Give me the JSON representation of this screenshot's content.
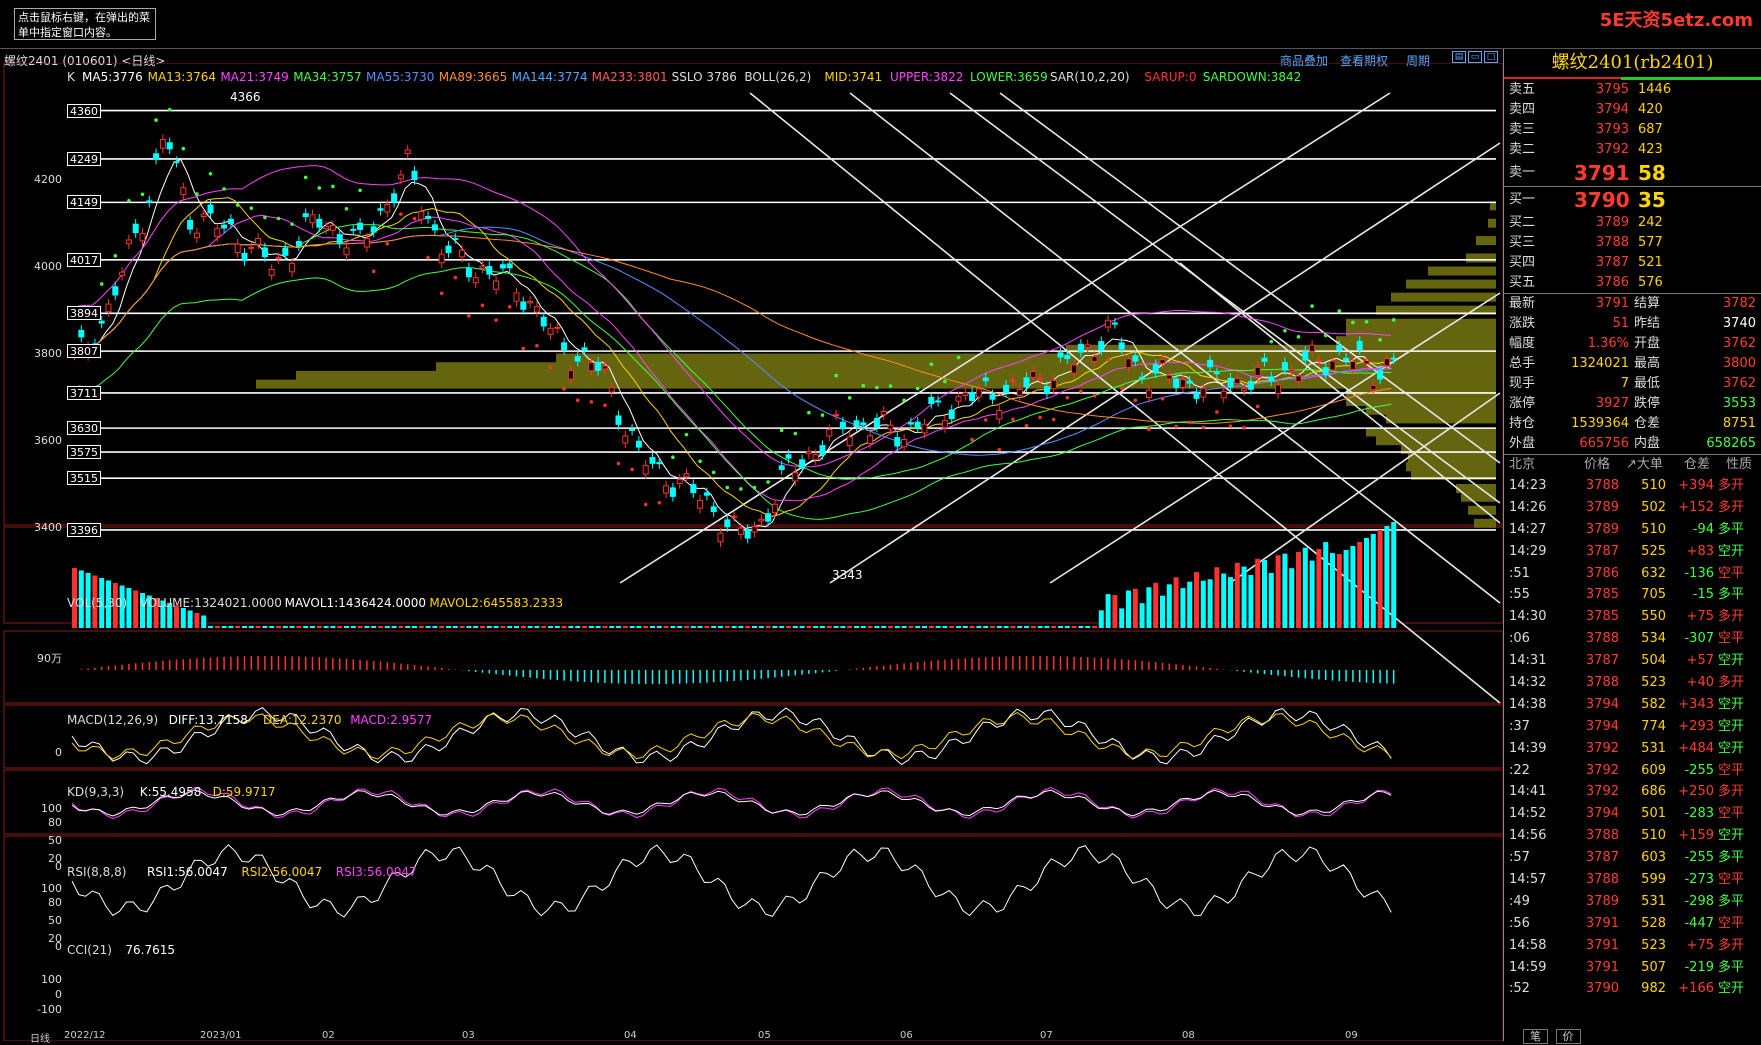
{
  "header": {
    "tip": "点击鼠标右键，在弹出的菜单中指定窗口内容。",
    "brand": "5E天资5etz.com",
    "contract": "螺纹2401 (010601) <日线>",
    "links": [
      "商品叠加",
      "查看期权",
      "周期"
    ]
  },
  "main_indicator": {
    "k": "K",
    "items": [
      {
        "text": "MA5:3776",
        "color": "#ffffff"
      },
      {
        "text": "MA13:3764",
        "color": "#ffd400"
      },
      {
        "text": "MA21:3749",
        "color": "#ff40ff"
      },
      {
        "text": "MA34:3757",
        "color": "#40ff40"
      },
      {
        "text": "MA55:3730",
        "color": "#5a8cff"
      },
      {
        "text": "MA89:3665",
        "color": "#ff8a2a"
      },
      {
        "text": "MA144:3774",
        "color": "#4fa8ff"
      },
      {
        "text": "MA233:3801",
        "color": "#ff5a5a"
      },
      {
        "text": "SSLO 3786",
        "color": "#dddddd"
      },
      {
        "text": "BOLL(26,2)",
        "color": "#dddddd"
      },
      {
        "text": "MID:3741",
        "color": "#ffd400"
      },
      {
        "text": "UPPER:3822",
        "color": "#ff40ff"
      },
      {
        "text": "LOWER:3659",
        "color": "#40ff40"
      },
      {
        "text": "SAR(10,2,20)",
        "color": "#dddddd"
      },
      {
        "text": "SARUP:0",
        "color": "#ff3030"
      },
      {
        "text": "SARDOWN:3842",
        "color": "#40ff40"
      }
    ]
  },
  "price_axis": [
    "4200",
    "4000",
    "3800",
    "3600",
    "3400"
  ],
  "price_levels": [
    "4360",
    "4249",
    "4149",
    "4017",
    "3894",
    "3807",
    "3711",
    "3630",
    "3575",
    "3515",
    "3396"
  ],
  "price_marks": {
    "high": "4366",
    "low": "3343"
  },
  "volume_indicator": {
    "items": [
      {
        "text": "VOL(5,30)",
        "color": "#dddddd"
      },
      {
        "text": "VOLUME:1324021.0000",
        "color": "#dddddd"
      },
      {
        "text": "MAVOL1:1436424.0000",
        "color": "#ffffff"
      },
      {
        "text": "MAVOL2:645583.2333",
        "color": "#ffd400"
      }
    ],
    "axis": "90万"
  },
  "macd_indicator": {
    "items": [
      {
        "text": "MACD(12,26,9)",
        "color": "#dddddd"
      },
      {
        "text": "DIFF:13.7158",
        "color": "#ffffff"
      },
      {
        "text": "DEA:12.2370",
        "color": "#ffd400"
      },
      {
        "text": "MACD:2.9577",
        "color": "#ff40ff"
      }
    ],
    "axis": [
      "0"
    ]
  },
  "kd_indicator": {
    "items": [
      {
        "text": "KD(9,3,3)",
        "color": "#dddddd"
      },
      {
        "text": "K:55.4958",
        "color": "#ffffff"
      },
      {
        "text": "D:59.9717",
        "color": "#ffd400"
      }
    ],
    "axis": [
      "100",
      "80",
      "50",
      "20",
      "0"
    ]
  },
  "rsi_indicator": {
    "items": [
      {
        "text": "RSI(8,8,8)",
        "color": "#dddddd"
      },
      {
        "text": "RSI1:56.0047",
        "color": "#ffffff"
      },
      {
        "text": "RSI2:56.0047",
        "color": "#ffd400"
      },
      {
        "text": "RSI3:56.0047",
        "color": "#ff40ff"
      }
    ],
    "axis": [
      "100",
      "80",
      "50",
      "20",
      "0"
    ]
  },
  "cci_indicator": {
    "items": [
      {
        "text": "CCI(21)",
        "color": "#dddddd"
      },
      {
        "text": "76.7615",
        "color": "#ffffff"
      }
    ],
    "axis": [
      "100",
      "0",
      "-100"
    ]
  },
  "date_axis": [
    "日线",
    "2022/12",
    "2023/01",
    "02",
    "03",
    "04",
    "05",
    "06",
    "07",
    "08",
    "09"
  ],
  "quote": {
    "title": "螺纹2401(rb2401)",
    "asks": [
      {
        "label": "卖五",
        "price": "3795",
        "vol": "1446"
      },
      {
        "label": "卖四",
        "price": "3794",
        "vol": "420"
      },
      {
        "label": "卖三",
        "price": "3793",
        "vol": "687"
      },
      {
        "label": "卖二",
        "price": "3792",
        "vol": "423"
      },
      {
        "label": "卖一",
        "price": "3791",
        "vol": "58"
      }
    ],
    "bids": [
      {
        "label": "买一",
        "price": "3790",
        "vol": "35"
      },
      {
        "label": "买二",
        "price": "3789",
        "vol": "242"
      },
      {
        "label": "买三",
        "price": "3788",
        "vol": "577"
      },
      {
        "label": "买四",
        "price": "3787",
        "vol": "521"
      },
      {
        "label": "买五",
        "price": "3786",
        "vol": "576"
      }
    ],
    "stats": [
      {
        "l1": "最新",
        "v1": "3791",
        "c1": "#ff3b2f",
        "l2": "结算",
        "v2": "3782",
        "c2": "#ff3b2f"
      },
      {
        "l1": "涨跌",
        "v1": "51",
        "c1": "#ff3b2f",
        "l2": "昨结",
        "v2": "3740",
        "c2": "#ffffff"
      },
      {
        "l1": "幅度",
        "v1": "1.36%",
        "c1": "#ff3b2f",
        "l2": "开盘",
        "v2": "3762",
        "c2": "#ff3b2f"
      },
      {
        "l1": "总手",
        "v1": "1324021",
        "c1": "#ffd400",
        "l2": "最高",
        "v2": "3800",
        "c2": "#ff3b2f"
      },
      {
        "l1": "现手",
        "v1": "7",
        "c1": "#ffd400",
        "l2": "最低",
        "v2": "3762",
        "c2": "#ff3b2f"
      },
      {
        "l1": "涨停",
        "v1": "3927",
        "c1": "#ff3b2f",
        "l2": "跌停",
        "v2": "3553",
        "c2": "#40ff40"
      },
      {
        "l1": "持仓",
        "v1": "1539364",
        "c1": "#ffd400",
        "l2": "仓差",
        "v2": "8751",
        "c2": "#ffd400"
      },
      {
        "l1": "外盘",
        "v1": "665756",
        "c1": "#ff3b2f",
        "l2": "内盘",
        "v2": "658265",
        "c2": "#40ff40"
      }
    ],
    "trade_header": [
      "北京",
      "价格",
      "↗大单",
      "仓差",
      "性质"
    ],
    "trades": [
      {
        "t": "14:23",
        "p": "3788",
        "v": "510",
        "c": "+394",
        "n": "多开",
        "nc": "#ff3b2f"
      },
      {
        "t": "14:26",
        "p": "3789",
        "v": "502",
        "c": "+152",
        "n": "多开",
        "nc": "#ff3b2f"
      },
      {
        "t": "14:27",
        "p": "3789",
        "v": "510",
        "c": "-94",
        "n": "多平",
        "nc": "#40ff40"
      },
      {
        "t": "14:29",
        "p": "3787",
        "v": "525",
        "c": "+83",
        "n": "空开",
        "nc": "#40ff40"
      },
      {
        "t": ":51",
        "p": "3786",
        "v": "632",
        "c": "-136",
        "n": "空平",
        "nc": "#ff3b2f"
      },
      {
        "t": ":55",
        "p": "3785",
        "v": "705",
        "c": "-15",
        "n": "多平",
        "nc": "#40ff40"
      },
      {
        "t": "14:30",
        "p": "3785",
        "v": "550",
        "c": "+75",
        "n": "多开",
        "nc": "#ff3b2f"
      },
      {
        "t": ":06",
        "p": "3788",
        "v": "534",
        "c": "-307",
        "n": "空平",
        "nc": "#ff3b2f"
      },
      {
        "t": "14:31",
        "p": "3787",
        "v": "504",
        "c": "+57",
        "n": "空开",
        "nc": "#40ff40"
      },
      {
        "t": "14:32",
        "p": "3788",
        "v": "523",
        "c": "+40",
        "n": "多开",
        "nc": "#ff3b2f"
      },
      {
        "t": "14:38",
        "p": "3794",
        "v": "582",
        "c": "+343",
        "n": "空开",
        "nc": "#40ff40"
      },
      {
        "t": ":37",
        "p": "3794",
        "v": "774",
        "c": "+293",
        "n": "空开",
        "nc": "#40ff40"
      },
      {
        "t": "14:39",
        "p": "3792",
        "v": "531",
        "c": "+484",
        "n": "空开",
        "nc": "#40ff40"
      },
      {
        "t": ":22",
        "p": "3792",
        "v": "609",
        "c": "-255",
        "n": "空平",
        "nc": "#ff3b2f"
      },
      {
        "t": "14:41",
        "p": "3792",
        "v": "686",
        "c": "+250",
        "n": "多开",
        "nc": "#ff3b2f"
      },
      {
        "t": "14:52",
        "p": "3794",
        "v": "501",
        "c": "-283",
        "n": "空平",
        "nc": "#ff3b2f"
      },
      {
        "t": "14:56",
        "p": "3788",
        "v": "510",
        "c": "+159",
        "n": "空开",
        "nc": "#40ff40"
      },
      {
        "t": ":57",
        "p": "3787",
        "v": "603",
        "c": "-255",
        "n": "多平",
        "nc": "#40ff40"
      },
      {
        "t": "14:57",
        "p": "3788",
        "v": "599",
        "c": "-273",
        "n": "空平",
        "nc": "#ff3b2f"
      },
      {
        "t": ":49",
        "p": "3789",
        "v": "531",
        "c": "-298",
        "n": "多平",
        "nc": "#40ff40"
      },
      {
        "t": ":56",
        "p": "3791",
        "v": "528",
        "c": "-447",
        "n": "空平",
        "nc": "#ff3b2f"
      },
      {
        "t": "14:58",
        "p": "3791",
        "v": "523",
        "c": "+75",
        "n": "多开",
        "nc": "#ff3b2f"
      },
      {
        "t": "14:59",
        "p": "3791",
        "v": "507",
        "c": "-219",
        "n": "多平",
        "nc": "#40ff40"
      },
      {
        "t": ":52",
        "p": "3790",
        "v": "982",
        "c": "+166",
        "n": "空开",
        "nc": "#40ff40"
      }
    ],
    "tabs": [
      "笔",
      "价"
    ]
  }
}
